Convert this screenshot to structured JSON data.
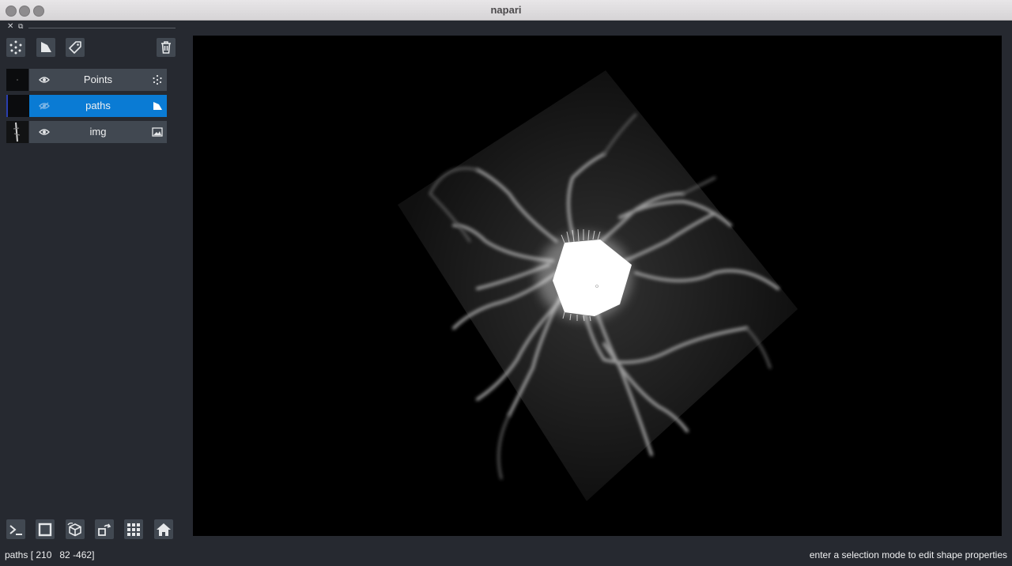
{
  "window": {
    "title": "napari"
  },
  "dock": {
    "close_glyph": "✕",
    "float_glyph": "⧉"
  },
  "layer_buttons": [
    {
      "name": "new-points-icon"
    },
    {
      "name": "new-shapes-icon"
    },
    {
      "name": "new-labels-icon"
    },
    {
      "name": "delete-layer-icon"
    }
  ],
  "layers": [
    {
      "name": "Points",
      "visible": true,
      "selected": false,
      "type_icon": "points-icon"
    },
    {
      "name": "paths",
      "visible": false,
      "selected": true,
      "type_icon": "shapes-icon"
    },
    {
      "name": "img",
      "visible": true,
      "selected": false,
      "type_icon": "image-icon"
    }
  ],
  "bottom_buttons": [
    {
      "name": "console-icon"
    },
    {
      "name": "ndisplay-square-icon"
    },
    {
      "name": "roll-cube-icon"
    },
    {
      "name": "transpose-icon"
    },
    {
      "name": "grid-icon"
    },
    {
      "name": "home-icon"
    }
  ],
  "status": {
    "left": "paths [ 210   82 -462]",
    "right": "enter a selection mode to edit shape properties"
  },
  "colors": {
    "background": "#262930",
    "panel_button": "#414851",
    "selected": "#0a7bd4",
    "canvas": "#000000",
    "text": "#f0f1f2"
  }
}
